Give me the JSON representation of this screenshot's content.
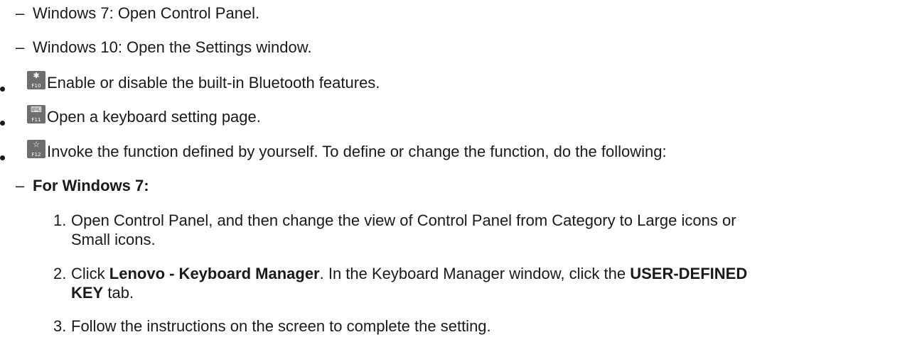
{
  "lines": {
    "win7_open": "Windows 7: Open Control Panel.",
    "win10_open": "Windows 10: Open the Settings window.",
    "f10_text": "Enable or disable the built-in Bluetooth features.",
    "f11_text": "Open a keyboard setting page.",
    "f12_text": "Invoke the function defined by yourself. To define or change the function, do the following:",
    "for_win7": "For Windows 7:"
  },
  "keys": {
    "f10": {
      "label": "F10",
      "icon": "bluetooth-icon",
      "glyph": "✱"
    },
    "f11": {
      "label": "F11",
      "icon": "keyboard-icon",
      "glyph": "⌨"
    },
    "f12": {
      "label": "F12",
      "icon": "star-icon",
      "glyph": "☆"
    }
  },
  "steps": [
    {
      "num": "1.",
      "line1": "Open Control Panel, and then change the view of Control Panel from Category to Large icons or",
      "line2": "Small icons."
    },
    {
      "num": "2.",
      "pre": "Click ",
      "bold1": "Lenovo - Keyboard Manager",
      "mid": ". In the Keyboard Manager window, click the ",
      "bold2": "USER-DEFINED",
      "bold3": "KEY",
      "post": " tab."
    },
    {
      "num": "3.",
      "line1": "Follow the instructions on the screen to complete the setting."
    }
  ],
  "dash": "–"
}
